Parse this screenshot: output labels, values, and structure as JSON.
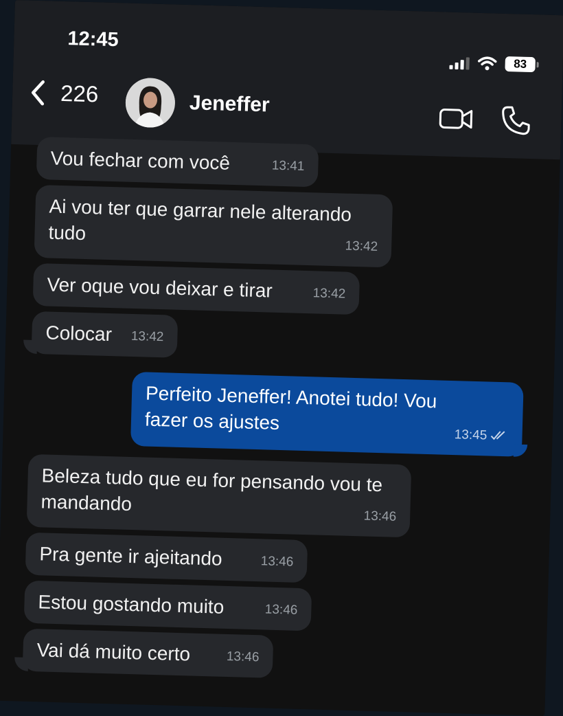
{
  "status_bar": {
    "time": "12:45",
    "battery": "83"
  },
  "header": {
    "back_count": "226",
    "contact_name": "Jeneffer"
  },
  "messages": [
    {
      "text": "Vou fechar com você",
      "time": "13:41",
      "dir": "in"
    },
    {
      "text": "Ai vou ter que garrar nele alterando tudo",
      "time": "13:42",
      "dir": "in"
    },
    {
      "text": "Ver oque vou deixar e tirar",
      "time": "13:42",
      "dir": "in"
    },
    {
      "text": "Colocar",
      "time": "13:42",
      "dir": "in"
    },
    {
      "text": "Perfeito Jeneffer! Anotei tudo! Vou fazer os ajustes",
      "time": "13:45",
      "dir": "out",
      "read": true
    },
    {
      "text": "Beleza tudo que eu for pensando vou te mandando",
      "time": "13:46",
      "dir": "in"
    },
    {
      "text": "Pra gente ir ajeitando",
      "time": "13:46",
      "dir": "in"
    },
    {
      "text": "Estou gostando muito",
      "time": "13:46",
      "dir": "in"
    },
    {
      "text": "Vai dá muito certo",
      "time": "13:46",
      "dir": "in"
    }
  ],
  "colors": {
    "incoming": "#26282c",
    "outgoing": "#0b4a9c",
    "background": "#111111",
    "header": "#1c1e22"
  },
  "icons": [
    "chevron-left-icon",
    "video-camera-icon",
    "phone-icon",
    "signal-icon",
    "wifi-icon",
    "battery-icon",
    "double-check-icon"
  ]
}
